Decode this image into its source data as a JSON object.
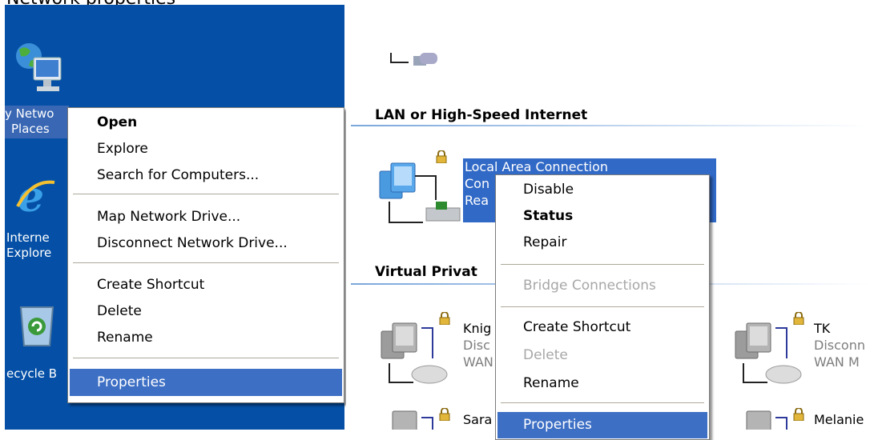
{
  "caption": "Network properties",
  "desktop": {
    "icons": [
      {
        "name": "My Network Places",
        "label_line1": "y Netwo",
        "label_line2": "Places",
        "icon": "network-globe-icon"
      },
      {
        "name": "Internet Explorer",
        "label_line1": "Interne",
        "label_line2": "Explore",
        "icon": "internet-explorer-icon"
      },
      {
        "name": "Recycle Bin",
        "label_line1": "ecycle B",
        "icon": "recycle-bin-icon"
      }
    ]
  },
  "desktop_menu": {
    "items": [
      {
        "label": "Open",
        "bold": true
      },
      {
        "label": "Explore"
      },
      {
        "label": "Search for Computers..."
      },
      {
        "label": "Map Network Drive..."
      },
      {
        "label": "Disconnect Network Drive..."
      },
      {
        "label": "Create Shortcut"
      },
      {
        "label": "Delete"
      },
      {
        "label": "Rename"
      },
      {
        "label": "Properties",
        "highlighted": true
      }
    ]
  },
  "network_connections": {
    "lan_header": "LAN or High-Speed Internet",
    "vpn_header": "Virtual Privat",
    "lan": {
      "name": "Local Area Connection",
      "line2": "Con",
      "line3": "Rea",
      "selected": true
    },
    "vpn": [
      {
        "name": "Knig",
        "status": "Disc",
        "type": "WAN"
      },
      {
        "name": "Sara"
      },
      {
        "name": "TK",
        "status": "Disconn",
        "type": "WAN M"
      },
      {
        "name": "Melanie"
      }
    ]
  },
  "connection_menu": {
    "items": [
      {
        "label": "Disable"
      },
      {
        "label": "Status",
        "bold": true
      },
      {
        "label": "Repair"
      },
      {
        "label": "Bridge Connections",
        "disabled": true
      },
      {
        "label": "Create Shortcut"
      },
      {
        "label": "Delete",
        "disabled": true
      },
      {
        "label": "Rename"
      },
      {
        "label": "Properties",
        "highlighted": true
      }
    ]
  },
  "colors": {
    "desktop": "#0550a6",
    "highlight": "#3d6fc4",
    "lan_selection": "#3169c6"
  }
}
